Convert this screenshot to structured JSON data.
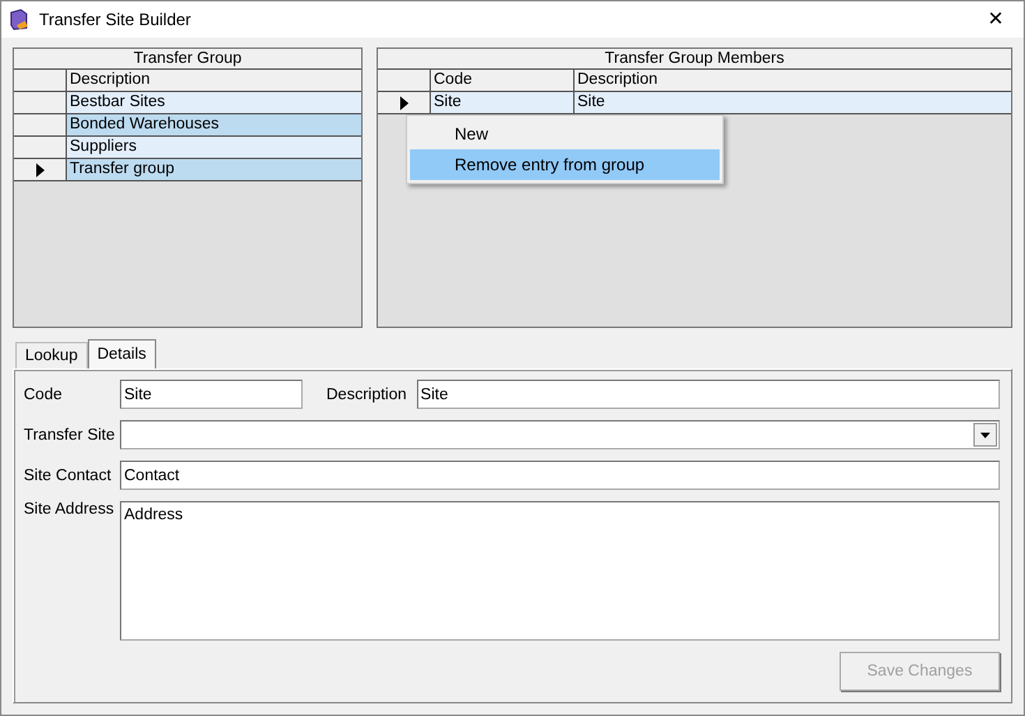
{
  "window": {
    "title": "Transfer Site Builder",
    "close": "✕"
  },
  "group_grid": {
    "title": "Transfer Group",
    "columns": [
      "Description"
    ],
    "rows": [
      {
        "cells": [
          "Bestbar Sites"
        ],
        "selected": false
      },
      {
        "cells": [
          "Bonded Warehouses"
        ],
        "selected": false
      },
      {
        "cells": [
          "Suppliers"
        ],
        "selected": false
      },
      {
        "cells": [
          "Transfer group"
        ],
        "selected": true
      }
    ]
  },
  "members_grid": {
    "title": "Transfer Group Members",
    "columns": [
      "Code",
      "Description"
    ],
    "rows": [
      {
        "cells": [
          "Site",
          "Site"
        ],
        "selected": true
      }
    ]
  },
  "context_menu": {
    "items": [
      {
        "label": "New",
        "selected": false
      },
      {
        "label": "Remove entry from group",
        "selected": true
      }
    ]
  },
  "tabs": [
    {
      "label": "Lookup",
      "selected": false
    },
    {
      "label": "Details",
      "selected": true
    }
  ],
  "details": {
    "code_label": "Code",
    "code": "Site",
    "description_label": "Description",
    "description": "Site",
    "transfer_site_label": "Transfer Site",
    "contact_label": "Site Contact",
    "contact": "Contact",
    "address_label": "Site Address",
    "address": "Address"
  },
  "save_button": {
    "label": "Save Changes",
    "disabled": true
  }
}
